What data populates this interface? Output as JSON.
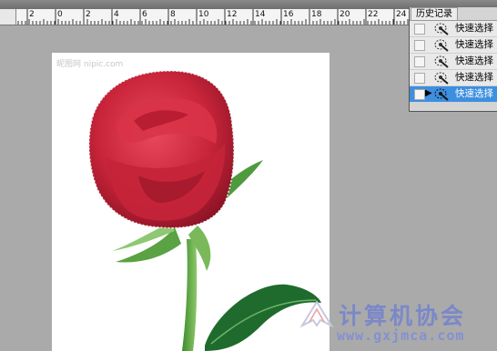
{
  "ruler": {
    "labels": [
      "2",
      "0",
      "2",
      "4",
      "6",
      "8",
      "10",
      "12",
      "14",
      "16",
      "18",
      "20",
      "22",
      "24"
    ]
  },
  "canvas": {
    "watermark": "昵图网 nipic.com"
  },
  "history_panel": {
    "tab_label": "历史记录",
    "items": [
      {
        "label": "快速选择",
        "selected": false,
        "icon": "quick-selection-icon"
      },
      {
        "label": "快速选择",
        "selected": false,
        "icon": "quick-selection-icon"
      },
      {
        "label": "快速选择",
        "selected": false,
        "icon": "quick-selection-icon"
      },
      {
        "label": "快速选择",
        "selected": false,
        "icon": "quick-selection-icon"
      },
      {
        "label": "快速选择",
        "selected": true,
        "icon": "quick-selection-icon"
      }
    ]
  },
  "branding": {
    "name": "计算机协会",
    "url": "www.gxjmca.com"
  },
  "colors": {
    "workspace": "#aaaaaa",
    "selection_highlight": "#3d8fe0",
    "rose": "#c8243a",
    "logo": "#7b88c8"
  }
}
